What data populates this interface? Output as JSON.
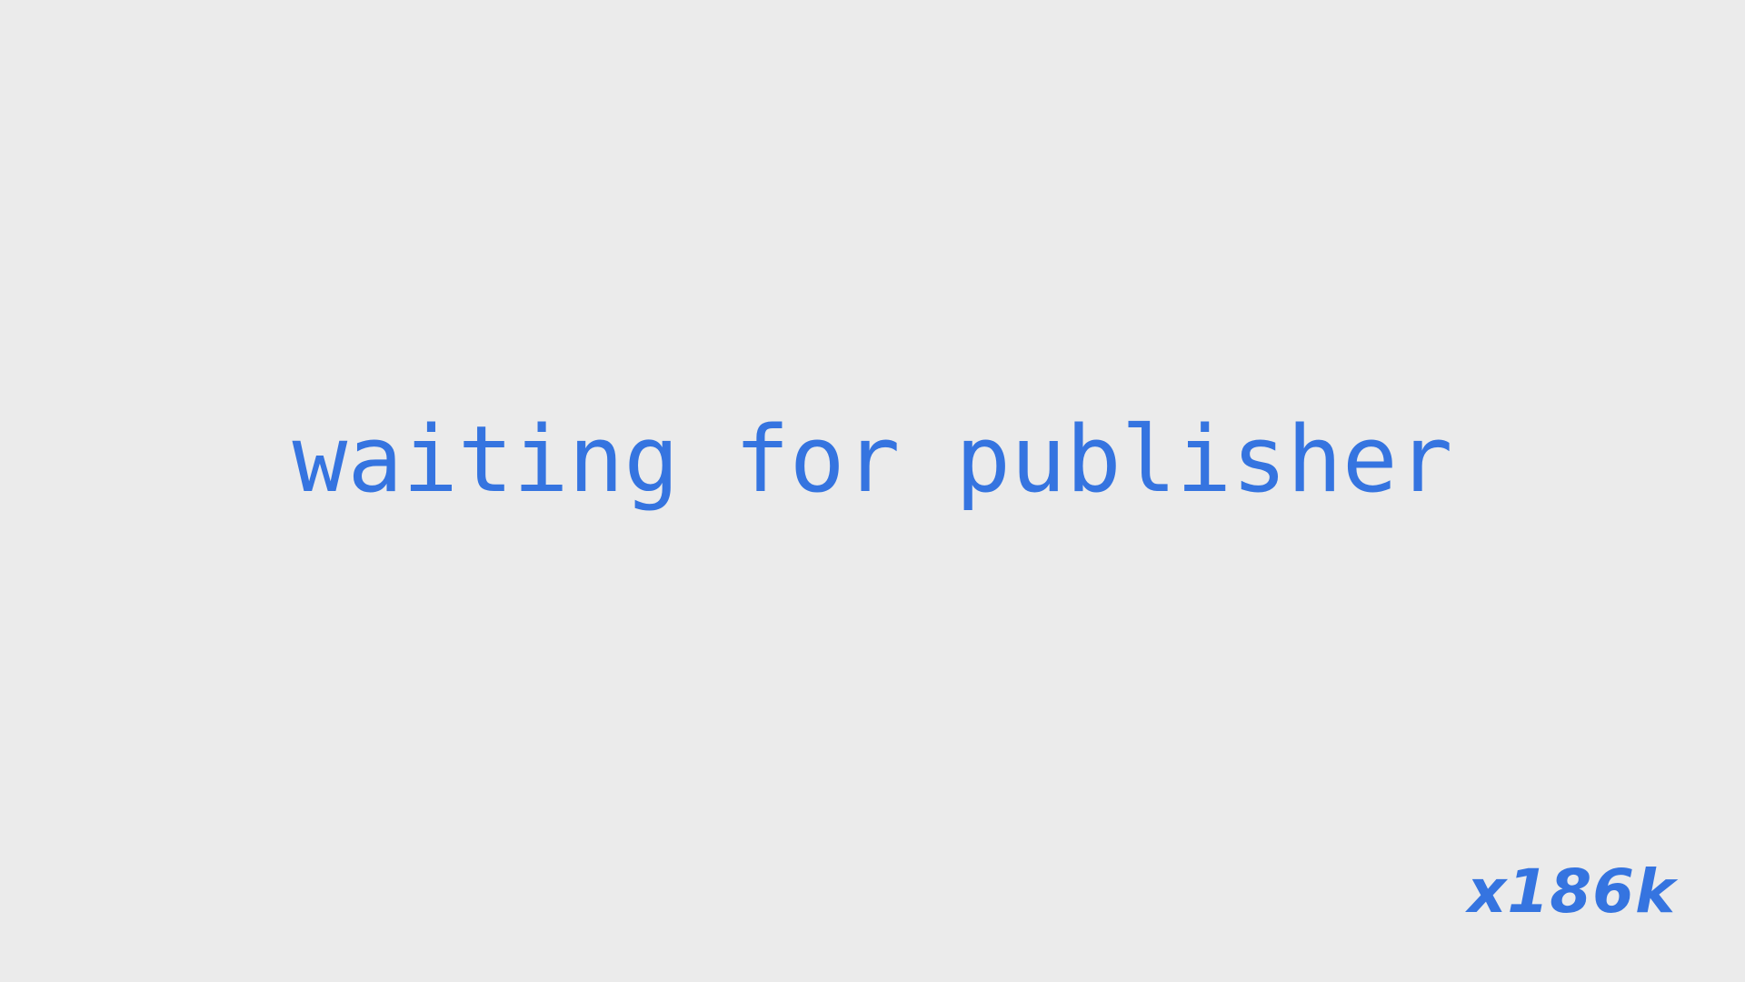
{
  "status": {
    "message": "waiting for publisher"
  },
  "branding": {
    "logo_text": "x186k"
  },
  "colors": {
    "accent": "#3574e0",
    "background": "#ebebeb"
  }
}
